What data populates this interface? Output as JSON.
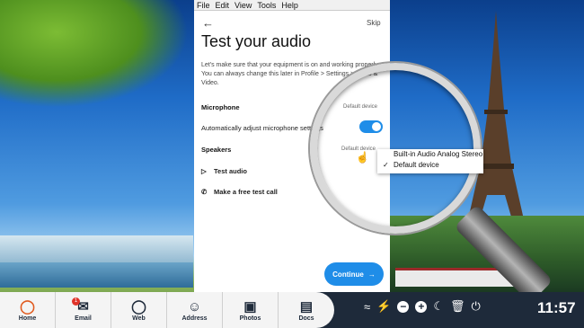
{
  "menubar": {
    "items": [
      "File",
      "Edit",
      "View",
      "Tools",
      "Help"
    ]
  },
  "app": {
    "skip_label": "Skip",
    "title": "Test your audio",
    "description": "Let's make sure that your equipment is on and working properly. You can always change this later in Profile > Settings > Audio & Video.",
    "microphone": {
      "heading": "Microphone",
      "device": "Default device",
      "auto_adjust_label": "Automatically adjust microphone settings",
      "auto_adjust_on": true
    },
    "speakers": {
      "heading": "Speakers",
      "device": "Default device"
    },
    "test_audio_label": "Test audio",
    "free_call_label": "Make a free test call",
    "continue_label": "Continue",
    "accent_color": "#1f8de8"
  },
  "dropdown": {
    "options": [
      "Built-in Audio Analog Stereo",
      "Default device"
    ],
    "selected": "Default device",
    "check": "✓"
  },
  "dock": {
    "items": [
      {
        "label": "Home",
        "icon": "home-icon"
      },
      {
        "label": "Email",
        "icon": "email-icon"
      },
      {
        "label": "Web",
        "icon": "globe-icon"
      },
      {
        "label": "Address",
        "icon": "address-icon"
      },
      {
        "label": "Photos",
        "icon": "camera-icon"
      },
      {
        "label": "Docs",
        "icon": "docs-icon"
      }
    ],
    "email_badge": "1"
  },
  "tray": {
    "time": "11:57"
  }
}
